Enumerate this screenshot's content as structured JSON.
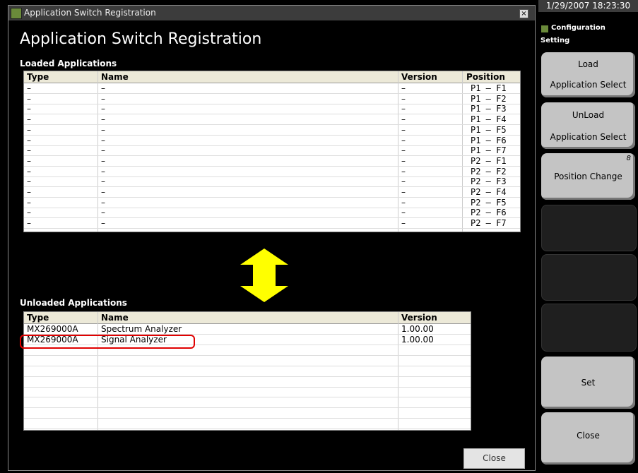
{
  "window": {
    "title": "Application Switch Registration",
    "close_glyph": "×"
  },
  "header": {
    "title": "Application Switch Registration"
  },
  "loaded": {
    "label": "Loaded Applications",
    "columns": [
      "Type",
      "Name",
      "Version",
      "Position"
    ],
    "rows": [
      {
        "type": "–",
        "name": "–",
        "version": "–",
        "position": "P1 – F1"
      },
      {
        "type": "–",
        "name": "–",
        "version": "–",
        "position": "P1 – F2"
      },
      {
        "type": "–",
        "name": "–",
        "version": "–",
        "position": "P1 – F3"
      },
      {
        "type": "–",
        "name": "–",
        "version": "–",
        "position": "P1 – F4"
      },
      {
        "type": "–",
        "name": "–",
        "version": "–",
        "position": "P1 – F5"
      },
      {
        "type": "–",
        "name": "–",
        "version": "–",
        "position": "P1 – F6"
      },
      {
        "type": "–",
        "name": "–",
        "version": "–",
        "position": "P1 – F7"
      },
      {
        "type": "–",
        "name": "–",
        "version": "–",
        "position": "P2 – F1"
      },
      {
        "type": "–",
        "name": "–",
        "version": "–",
        "position": "P2 – F2"
      },
      {
        "type": "–",
        "name": "–",
        "version": "–",
        "position": "P2 – F3"
      },
      {
        "type": "–",
        "name": "–",
        "version": "–",
        "position": "P2 – F4"
      },
      {
        "type": "–",
        "name": "–",
        "version": "–",
        "position": "P2 – F5"
      },
      {
        "type": "–",
        "name": "–",
        "version": "–",
        "position": "P2 – F6"
      },
      {
        "type": "–",
        "name": "–",
        "version": "–",
        "position": "P2 – F7"
      }
    ]
  },
  "unloaded": {
    "label": "Unloaded Applications",
    "columns": [
      "Type",
      "Name",
      "Version"
    ],
    "rows": [
      {
        "type": "MX269000A",
        "name": "Spectrum Analyzer",
        "version": "1.00.00"
      },
      {
        "type": "MX269000A",
        "name": "Signal Analyzer",
        "version": "1.00.00"
      }
    ]
  },
  "close_button": "Close",
  "sidebar": {
    "datetime": "1/29/2007 18:23:30",
    "section_title": "Configuration",
    "section_sub": "Setting",
    "softkeys": {
      "load": {
        "line1": "Load",
        "line2": "Application Select"
      },
      "unload": {
        "line1": "UnLoad",
        "line2": "Application Select"
      },
      "position": {
        "label": "Position Change",
        "number": "8"
      },
      "set": "Set",
      "close": "Close"
    }
  },
  "colors": {
    "arrow": "#ffff00",
    "highlight": "#e00000"
  }
}
